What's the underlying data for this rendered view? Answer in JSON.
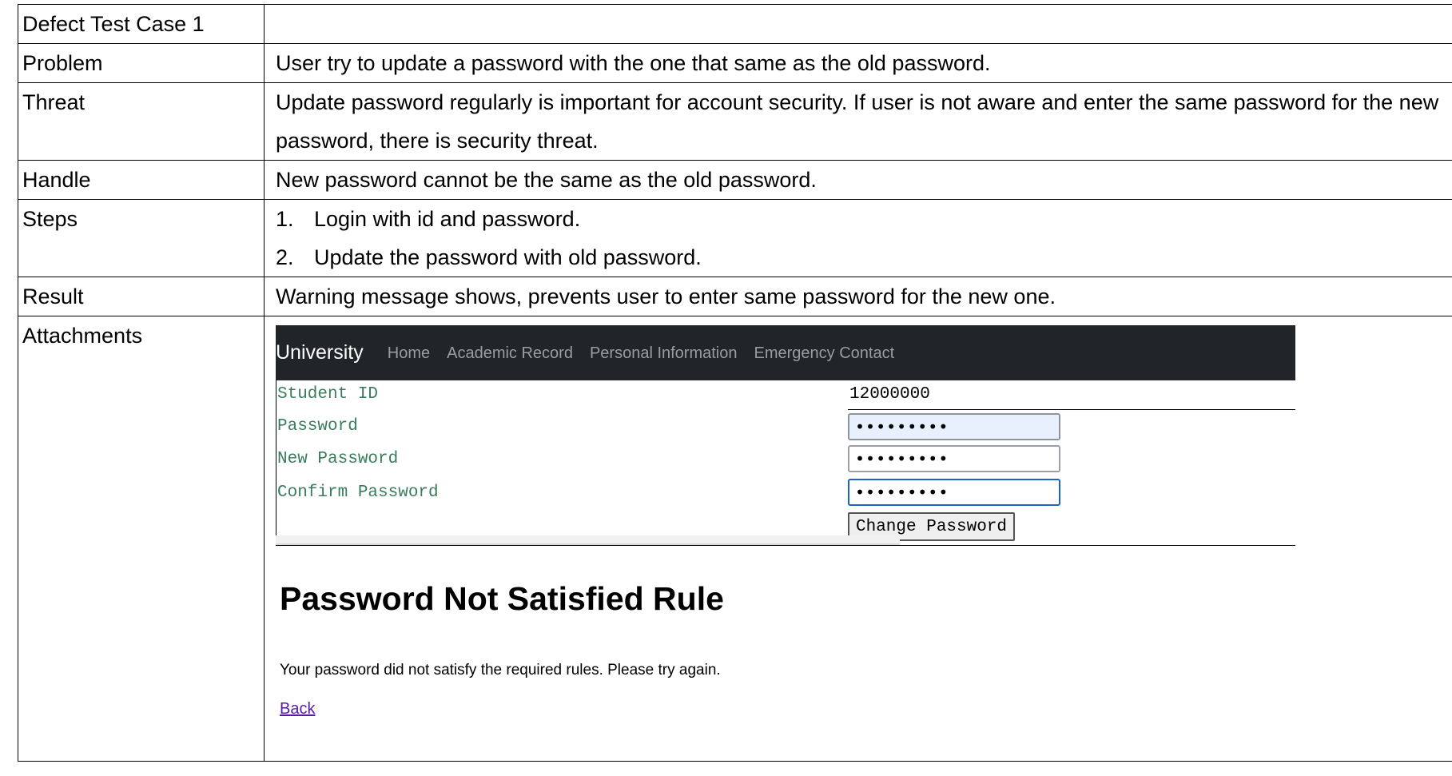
{
  "title": "Defect Test Case 1",
  "rows": {
    "problem": {
      "label": "Problem",
      "text": "User try to update a password with the one that same as the old password."
    },
    "threat": {
      "label": "Threat",
      "text": "Update password regularly is important for account security. If user is not aware and enter the same password for the new password, there is security threat."
    },
    "handle": {
      "label": "Handle",
      "text": "New password cannot be the same as the old password."
    },
    "steps": {
      "label": "Steps",
      "items": [
        {
          "num": "1.",
          "text": "Login with id and password."
        },
        {
          "num": "2.",
          "text": "Update the password with old password."
        }
      ]
    },
    "result": {
      "label": "Result",
      "text": "Warning message shows, prevents user to enter same password for the new one."
    },
    "attachments": {
      "label": "Attachments"
    }
  },
  "screenshot": {
    "navbar": {
      "brand": "University",
      "links": [
        "Home",
        "Academic Record",
        "Personal Information",
        "Emergency Contact"
      ]
    },
    "form": {
      "student_id_label": "Student ID",
      "student_id_value": "12000000",
      "password_label": "Password",
      "password_value": "•••••••••",
      "new_password_label": "New Password",
      "new_password_value": "•••••••••",
      "confirm_password_label": "Confirm Password",
      "confirm_password_value": "•••••••••",
      "change_button": "Change Password"
    },
    "result_title": "Password Not Satisfied Rule",
    "result_text": "Your password did not satisfy the required rules. Please try again.",
    "back_link": "Back"
  },
  "colors": {
    "navbar_bg": "#212529",
    "label_green": "#3a7d5c",
    "link_purple": "#5a18a8",
    "focus_blue": "#1a62c9"
  }
}
